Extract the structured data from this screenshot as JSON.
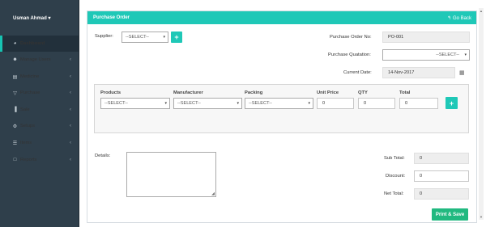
{
  "user": {
    "name": "Usman Ahmad"
  },
  "sidebar": {
    "items": [
      {
        "label": "Dashboard",
        "icon": "dashboard-icon",
        "glyph": "◕"
      },
      {
        "label": "Manage Users",
        "icon": "users-icon",
        "glyph": "☻",
        "chev": "‹"
      },
      {
        "label": "Medicine",
        "icon": "medicine-icon",
        "glyph": "▤",
        "chev": "‹"
      },
      {
        "label": "Purchase",
        "icon": "cart-icon",
        "glyph": "▽",
        "chev": "‹"
      },
      {
        "label": "Sale",
        "icon": "chart-icon",
        "glyph": "▐",
        "chev": "‹"
      },
      {
        "label": "Setups",
        "icon": "gear-icon",
        "glyph": "⚙",
        "chev": "‹"
      },
      {
        "label": "Items",
        "icon": "list-icon",
        "glyph": "☰",
        "chev": "‹"
      },
      {
        "label": "Reports",
        "icon": "report-icon",
        "glyph": "□",
        "chev": "‹"
      }
    ]
  },
  "panel": {
    "title": "Purchase Order",
    "back_label": "Go Back",
    "back_glyph": "↰"
  },
  "form": {
    "supplier_label": "Supplier:",
    "supplier_value": "--SELECT--",
    "po_no_label": "Purchase Order No:",
    "po_no_value": "PO-001",
    "quotation_label": "Purchase Quatation:",
    "quotation_value": "--SELECT--",
    "date_label": "Current Date:",
    "date_value": "14-Nov-2017",
    "details_label": "Details:"
  },
  "items_table": {
    "headers": [
      "Products",
      "Manufacturer",
      "Packing",
      "Unit Price",
      "QTY",
      "Total"
    ],
    "product_value": "--SELECT--",
    "manufacturer_value": "--SELECT--",
    "packing_value": "--SELECT--",
    "unit_price_value": "0",
    "qty_value": "0",
    "total_value": "0"
  },
  "totals": {
    "sub_total_label": "Sub Total:",
    "sub_total_value": "0",
    "discount_label": "Discount:",
    "discount_value": "0",
    "net_total_label": "Net Total:",
    "net_total_value": "0"
  },
  "actions": {
    "save_label": "Print & Save",
    "add_glyph": "+"
  },
  "colors": {
    "accent": "#1fc8b7",
    "sidebar_bg": "#2f3f4b",
    "save_green": "#21b980"
  }
}
